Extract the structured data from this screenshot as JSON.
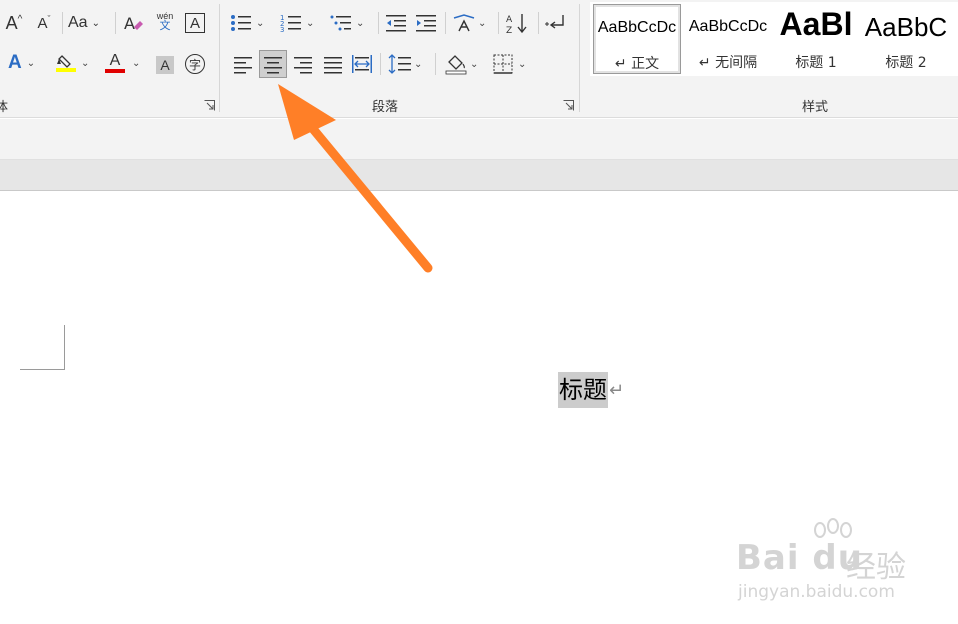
{
  "ribbon": {
    "font_group": {
      "label_partial": "体",
      "buttons": {
        "grow_font": "A",
        "shrink_font": "A",
        "change_case": "Aa",
        "clear_format": "A",
        "phonetic_top": "wén",
        "phonetic_bottom": "文",
        "char_border": "A",
        "text_effects": "A",
        "font_color": "A",
        "char_shading": "A",
        "enclose_char": "字"
      },
      "highlight_color": "#ffff00",
      "font_color_value": "#e00000"
    },
    "paragraph_group": {
      "label": "段落",
      "sort_label": "AZ",
      "active_alignment": "center"
    },
    "styles_group": {
      "label": "样式",
      "items": [
        {
          "sample": "AaBbCcDc",
          "name": "↵ 正文",
          "selected": true
        },
        {
          "sample": "AaBbCcDc",
          "name": "↵ 无间隔",
          "selected": false
        },
        {
          "sample": "AaBl",
          "name": "标题 1",
          "selected": false
        },
        {
          "sample": "AaBbC",
          "name": "标题 2",
          "selected": false
        }
      ]
    }
  },
  "document": {
    "heading_text": "标题",
    "paragraph_mark": "↵"
  },
  "annotation": {
    "arrow_color": "#ff7f27"
  },
  "watermark": {
    "logo": "Bai du",
    "cn": "经验",
    "url": "jingyan.baidu.com"
  },
  "colors": {
    "ribbon_bg": "#f3f3f3",
    "selection_highlight": "#cccccc",
    "accent_blue": "#2b6cc4"
  }
}
